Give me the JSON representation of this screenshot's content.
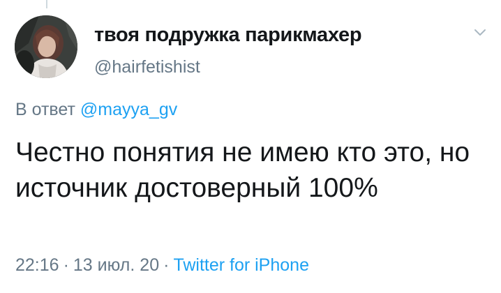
{
  "tweet": {
    "author": {
      "display_name": "твоя подружка парикмахер",
      "handle": "@hairfetishist"
    },
    "reply": {
      "prefix": "В ответ",
      "mention": "@mayya_gv"
    },
    "text": "Честно понятия не имею кто это, но источник достоверный 100%",
    "meta": {
      "time": "22:16",
      "separator": "·",
      "date": "13 июл. 20",
      "source": "Twitter for iPhone"
    },
    "icons": {
      "menu": "chevron-down-icon"
    },
    "colors": {
      "link": "#1da1f2",
      "secondary_text": "#657786",
      "primary_text": "#14171a"
    }
  }
}
